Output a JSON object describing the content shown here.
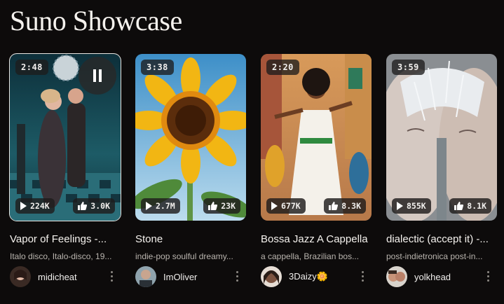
{
  "page": {
    "title": "Suno Showcase"
  },
  "songs": [
    {
      "title": "Vapor of Feelings -...",
      "duration": "2:48",
      "plays": "224K",
      "likes": "3.0K",
      "genre": "Italo disco, Italo-disco, 19...",
      "user": "midicheat",
      "playing": true
    },
    {
      "title": "Stone",
      "duration": "3:38",
      "plays": "2.7M",
      "likes": "23K",
      "genre": "indie-pop soulful dreamy...",
      "user": "ImOliver",
      "playing": false
    },
    {
      "title": "Bossa Jazz A Cappella",
      "duration": "2:20",
      "plays": "677K",
      "likes": "8.3K",
      "genre": "a cappella, Brazilian bos...",
      "user": "3Daizy🌼",
      "playing": false
    },
    {
      "title": "dialectic (accept it) -...",
      "duration": "3:59",
      "plays": "855K",
      "likes": "8.1K",
      "genre": "post-indietronica post-in...",
      "user": "yolkhead",
      "playing": false
    }
  ],
  "icons": {
    "play": "play-icon",
    "like": "thumbs-up-icon",
    "pause": "pause-icon",
    "more": "more-vertical-icon"
  }
}
